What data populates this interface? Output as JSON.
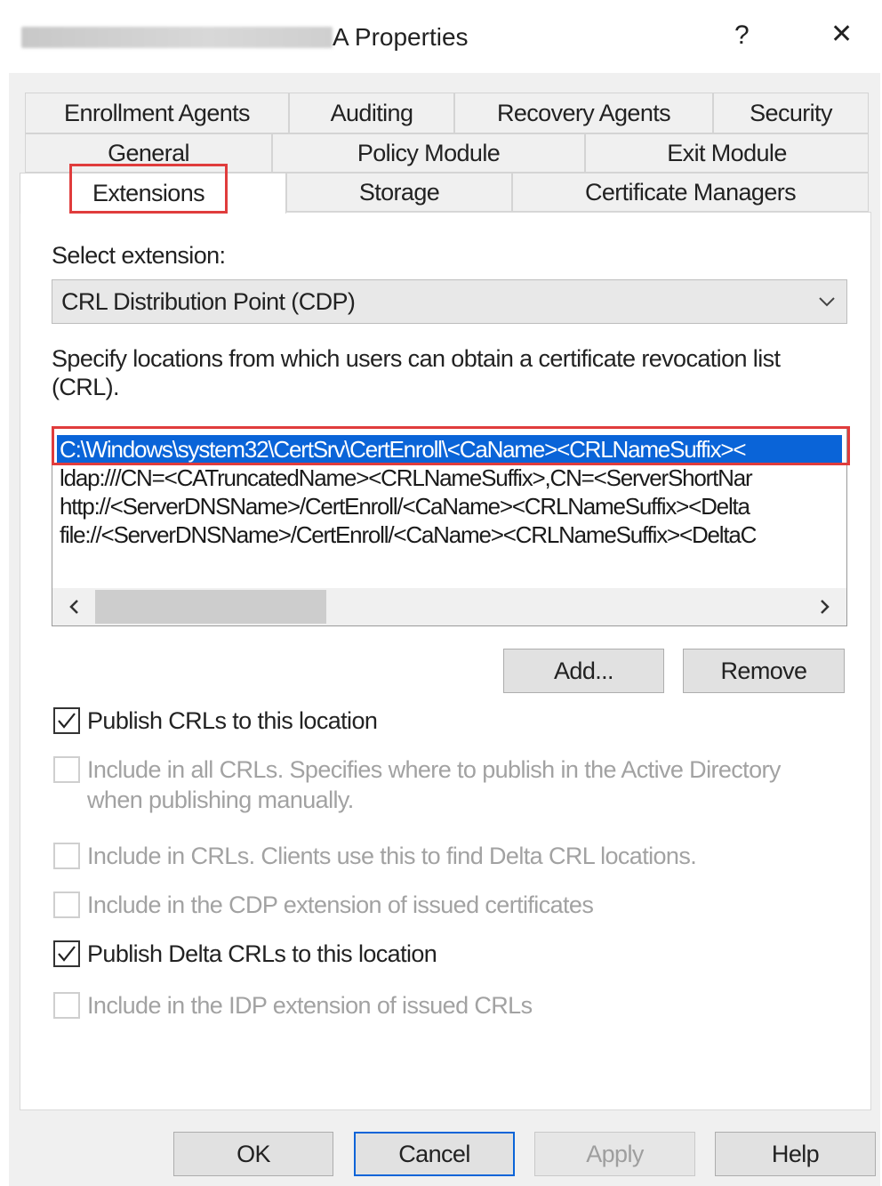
{
  "window": {
    "title": "A Properties",
    "help_glyph": "?",
    "close_glyph": "✕"
  },
  "tabs": {
    "row1": [
      "Enrollment Agents",
      "Auditing",
      "Recovery Agents",
      "Security"
    ],
    "row2": [
      "General",
      "Policy Module",
      "Exit Module"
    ],
    "row3": [
      "Extensions",
      "Storage",
      "Certificate Managers"
    ],
    "active": "Extensions"
  },
  "extensions": {
    "select_label": "Select extension:",
    "selected_extension": "CRL Distribution Point (CDP)",
    "description": "Specify locations from which users can obtain a certificate revocation list (CRL).",
    "description_line1": "Specify locations from which users can obtain a certificate revocation list",
    "description_line2": "(CRL).",
    "locations": [
      "C:\\Windows\\system32\\CertSrv\\CertEnroll\\<CaName><CRLNameSuffix><",
      "ldap:///CN=<CATruncatedName><CRLNameSuffix>,CN=<ServerShortNar",
      "http://<ServerDNSName>/CertEnroll/<CaName><CRLNameSuffix><Delta",
      "file://<ServerDNSName>/CertEnroll/<CaName><CRLNameSuffix><DeltaC"
    ],
    "selected_location_index": 0,
    "add_button": "Add...",
    "remove_button": "Remove"
  },
  "options": [
    {
      "label": "Publish CRLs to this location",
      "checked": true,
      "enabled": true
    },
    {
      "label": "Include in all CRLs. Specifies where to publish in the Active Directory",
      "label2": "when publishing manually.",
      "checked": false,
      "enabled": false
    },
    {
      "label": "Include in CRLs. Clients use this to find Delta CRL locations.",
      "checked": false,
      "enabled": false
    },
    {
      "label": "Include in the CDP extension of issued certificates",
      "checked": false,
      "enabled": false
    },
    {
      "label": "Publish Delta CRLs to this location",
      "checked": true,
      "enabled": true
    },
    {
      "label": "Include in the IDP extension of issued CRLs",
      "checked": false,
      "enabled": false
    }
  ],
  "footer": {
    "ok": "OK",
    "cancel": "Cancel",
    "apply": "Apply",
    "help": "Help"
  },
  "icons": {
    "dropdown": "chevron-down-icon",
    "scroll_left": "chevron-left-icon",
    "scroll_right": "chevron-right-icon",
    "check": "checkmark-icon"
  },
  "colors": {
    "selection": "#0a64d8",
    "highlight_box": "#e03c3c",
    "dialog_bg": "#f0f0f0"
  }
}
